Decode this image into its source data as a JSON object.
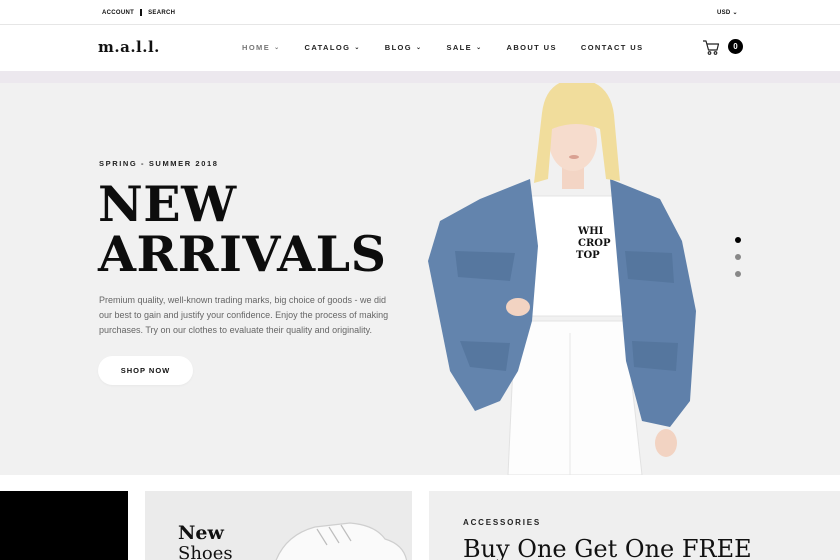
{
  "topbar": {
    "account_label": "ACCOUNT",
    "search_label": "SEARCH",
    "currency_label": "USD ⌄"
  },
  "header": {
    "logo": "m.a.l.l.",
    "nav": [
      {
        "label": "HOME",
        "has_dropdown": true,
        "active": true
      },
      {
        "label": "CATALOG",
        "has_dropdown": true
      },
      {
        "label": "BLOG",
        "has_dropdown": true
      },
      {
        "label": "SALE",
        "has_dropdown": true
      },
      {
        "label": "ABOUT US",
        "has_dropdown": false
      },
      {
        "label": "CONTACT US",
        "has_dropdown": false
      }
    ],
    "cart_icon": "cart-icon",
    "cart_count": "0"
  },
  "hero": {
    "eyebrow": "SPRING - SUMMER 2018",
    "headline_line1": "NEW",
    "headline_line2": "ARRIVALS",
    "description": "Premium quality, well-known trading marks, big choice of goods - we did our best to gain and justify your confidence. Enjoy the process of making purchases. Try on our clothes to evaluate their quality and originality.",
    "cta_label": "SHOP NOW",
    "tshirt_text": "WHI CROP TOP",
    "slides": [
      {
        "active": true
      },
      {
        "active": false
      },
      {
        "active": false
      }
    ]
  },
  "promos": {
    "shoes_title": "New",
    "shoes_subtitle": "Shoes",
    "accessories_label": "ACCESSORIES",
    "accessories_offer": "Buy One Get One FREE"
  },
  "colors": {
    "accent": "#000000",
    "hero_bg": "#f1f1f1",
    "strip": "#ece8ee",
    "denim": "#5f7fa6"
  }
}
